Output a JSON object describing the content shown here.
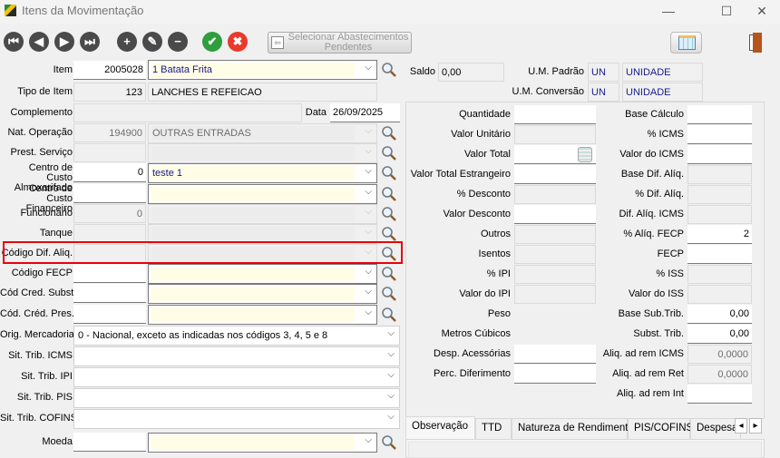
{
  "window": {
    "title": "Itens da Movimentação",
    "minimize": "—",
    "maximize": "☐",
    "close": "✕"
  },
  "toolbar": {
    "nav": [
      {
        "name": "first-record-button",
        "glyph": "⏮"
      },
      {
        "name": "previous-record-button",
        "glyph": "◀"
      },
      {
        "name": "next-record-button",
        "glyph": "▶"
      },
      {
        "name": "last-record-button",
        "glyph": "⏭"
      }
    ],
    "edit": [
      {
        "name": "add-button",
        "glyph": "+"
      },
      {
        "name": "edit-button",
        "glyph": "✎"
      },
      {
        "name": "delete-button",
        "glyph": "−"
      }
    ],
    "confirm": {
      "glyph": "✔",
      "color": "#2e9e3e"
    },
    "cancel": {
      "glyph": "✖",
      "color": "#e8392b"
    },
    "select_pending_label": "Selecionar Abastecimentos Pendentes"
  },
  "header": {
    "item": {
      "label": "Item",
      "code": "2005028",
      "desc": "1 Batata Frita"
    },
    "tipo": {
      "label": "Tipo de Item",
      "code": "123",
      "desc": "LANCHES E REFEICAO"
    },
    "complemento": {
      "label": "Complemento",
      "value": ""
    },
    "data": {
      "label": "Data",
      "value": "26/09/2025"
    },
    "saldo": {
      "label": "Saldo",
      "value": "0,00"
    },
    "um_padrao": {
      "label": "U.M. Padrão",
      "code": "UN",
      "desc": "UNIDADE"
    },
    "um_conversao": {
      "label": "U.M. Conversão",
      "code": "UN",
      "desc": "UNIDADE"
    }
  },
  "left_rows": [
    {
      "label": "Nat. Operação",
      "code": "194900",
      "desc": "OUTRAS ENTRADAS",
      "enabled": false
    },
    {
      "label": "Prest. Serviço",
      "code": "",
      "desc": "",
      "enabled": false
    },
    {
      "label": "Centro de Custo Almoxarifado",
      "code": "0",
      "desc": "teste 1",
      "enabled": true
    },
    {
      "label": "Centro de Custo Financeiro",
      "code": "",
      "desc": "",
      "enabled": true
    },
    {
      "label": "Funcionário",
      "code": "0",
      "desc": "",
      "enabled": false
    },
    {
      "label": "Tanque",
      "code": "",
      "desc": "",
      "enabled": false
    },
    {
      "label": "Código Dif. Aliq.",
      "code": "",
      "desc": "",
      "enabled": false,
      "highlighted": true
    },
    {
      "label": "Código FECP",
      "code": "",
      "desc": "",
      "enabled": true
    },
    {
      "label": "Cód Cred. Subst.",
      "code": "",
      "desc": "",
      "enabled": true
    },
    {
      "label": "Cód. Créd. Pres.",
      "code": "",
      "desc": "",
      "enabled": true
    }
  ],
  "situacao_rows": [
    {
      "label": "Orig. Mercadoria",
      "value": "0 - Nacional, exceto as indicadas nos códigos 3, 4, 5 e 8"
    },
    {
      "label": "Sit. Trib. ICMS",
      "value": ""
    },
    {
      "label": "Sit. Trib. IPI",
      "value": ""
    },
    {
      "label": "Sit. Trib. PIS",
      "value": ""
    },
    {
      "label": "Sit. Trib. COFINS",
      "value": ""
    }
  ],
  "moeda": {
    "label": "Moeda",
    "code": "",
    "desc": ""
  },
  "values_left": [
    {
      "label": "Quantidade",
      "value": "",
      "field": "enabled"
    },
    {
      "label": "Valor Unitário",
      "value": "",
      "field": "disabled"
    },
    {
      "label": "Valor Total",
      "value": "",
      "field": "enabled",
      "calculator": true
    },
    {
      "label": "Valor Total Estrangeiro",
      "value": "",
      "field": "enabled"
    },
    {
      "label": "% Desconto",
      "value": "",
      "field": "disabled"
    },
    {
      "label": "Valor Desconto",
      "value": "",
      "field": "enabled"
    },
    {
      "label": "Outros",
      "value": "",
      "field": "disabled"
    },
    {
      "label": "Isentos",
      "value": "",
      "field": "disabled"
    },
    {
      "label": "% IPI",
      "value": "",
      "field": "disabled"
    },
    {
      "label": "Valor do IPI",
      "value": "",
      "field": "disabled"
    },
    {
      "label": "Peso",
      "value": "",
      "field": "none"
    },
    {
      "label": "Metros Cúbicos",
      "value": "",
      "field": "none"
    },
    {
      "label": "Desp. Acessórias",
      "value": "",
      "field": "enabled"
    },
    {
      "label": "Perc. Diferimento",
      "value": "",
      "field": "enabled"
    }
  ],
  "values_right": [
    {
      "label": "Base Cálculo",
      "value": "",
      "field": "enabled"
    },
    {
      "label": "% ICMS",
      "value": "",
      "field": "enabled"
    },
    {
      "label": "Valor do ICMS",
      "value": "",
      "field": "enabled"
    },
    {
      "label": "Base Dif. Alíq.",
      "value": "",
      "field": "disabled"
    },
    {
      "label": "% Dif. Alíq.",
      "value": "",
      "field": "disabled"
    },
    {
      "label": "Dif. Alíq. ICMS",
      "value": "",
      "field": "disabled"
    },
    {
      "label": "% Alíq. FECP",
      "value": "2",
      "field": "enabled"
    },
    {
      "label": "FECP",
      "value": "",
      "field": "enabled"
    },
    {
      "label": "% ISS",
      "value": "",
      "field": "disabled"
    },
    {
      "label": "Valor do ISS",
      "value": "",
      "field": "disabled"
    },
    {
      "label": "Base Sub.Trib.",
      "value": "0,00",
      "field": "enabled"
    },
    {
      "label": "Subst. Trib.",
      "value": "0,00",
      "field": "enabled"
    },
    {
      "label": "Aliq. ad rem ICMS",
      "value": "0,0000",
      "field": "disabled"
    },
    {
      "label": "Aliq. ad rem Ret",
      "value": "0,0000",
      "field": "disabled"
    },
    {
      "label": "Aliq. ad rem Int",
      "value": "",
      "field": "enabled"
    }
  ],
  "tabs": [
    {
      "label": "Observação",
      "active": true
    },
    {
      "label": "TTD"
    },
    {
      "label": "Natureza de Rendimento"
    },
    {
      "label": "PIS/COFINS"
    },
    {
      "label": "Despesa"
    }
  ],
  "tab_scroll": {
    "left": "◂",
    "right": "▸"
  },
  "highlight_color": "#e8000b"
}
